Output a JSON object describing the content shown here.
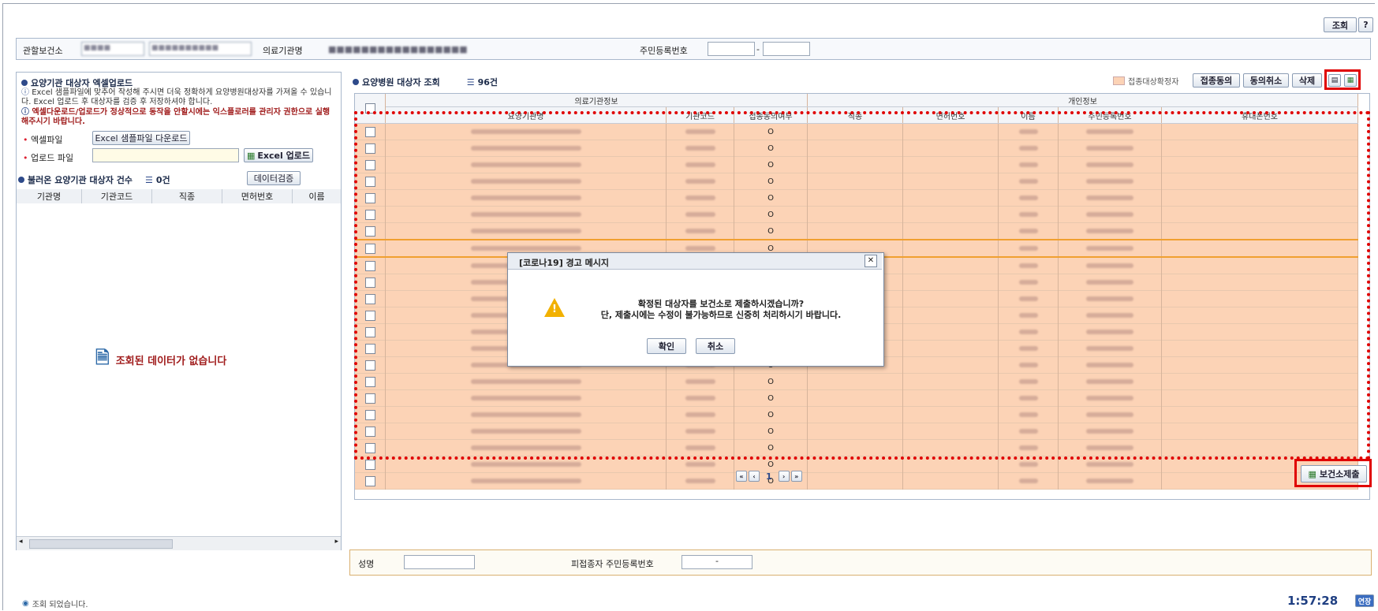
{
  "toolbar": {
    "search_label": "조회",
    "help_label": "?"
  },
  "filters": {
    "center_label": "관할보건소",
    "center_value1": "■■■■",
    "center_value2": "■■■■■■■■■■",
    "institution_label": "의료기관명",
    "institution_value": "■■■■■■■■■■■■■■■■■",
    "rrn_label": "주민등록번호",
    "rrn_sep": "-"
  },
  "upload": {
    "title": "요양기관 대상자 엑셀업로드",
    "info1": "Excel 샘플파일에 맞추어 작성해 주시면 더욱 정확하게 요양병원대상자를 가져올 수 있습니다. Excel 업로드 후 대상자를 검증 후 저장하셔야 합니다.",
    "info2": "엑셀다운로드/업로드가 정상적으로 동작을 안할시에는 익스플로러를 관리자 권한으로 실행해주시기 바랍니다.",
    "excel_file_label": "엑셀파일",
    "sample_download": "Excel 샘플파일 다운로드",
    "upload_file_label": "업로드 파일",
    "excel_upload_btn": "Excel 업로드"
  },
  "loaded": {
    "title": "불러온 요양기관 대상자 건수",
    "count": "0건",
    "verify_btn": "데이터검증",
    "columns": [
      "기관명",
      "기관코드",
      "직종",
      "면허번호",
      "이름"
    ],
    "empty_msg": "조회된 데이터가 없습니다"
  },
  "main": {
    "title": "요양병원 대상자 조회",
    "count": "96건",
    "legend_label": "접종대상확정자",
    "agree_btn": "접종동의",
    "cancel_agree_btn": "동의취소",
    "delete_btn": "삭제",
    "group1": "의료기관정보",
    "group2": "개인정보",
    "columns": [
      "요양기관명",
      "기관코드",
      "접종동의여부",
      "직종",
      "면허번호",
      "이름",
      "주민등록번호",
      "휴대폰번호"
    ],
    "consent_mark": "O",
    "pagination": {
      "current": "1"
    },
    "submit_btn": "보건소제출"
  },
  "bottom": {
    "name_label": "성명",
    "rrn_label": "피접종자 주민등록번호",
    "rrn_sep": "-"
  },
  "status": {
    "message": "조회 되었습니다.",
    "clock": "1:57:28",
    "extend": "연장"
  },
  "dialog": {
    "title": "[코로나19] 경고 메시지",
    "line1": "확정된 대상자를 보건소로 제출하시겠습니까?",
    "line2": "단, 제출시에는 수정이 불가능하므로 신중히 처리하시기 바랍니다.",
    "ok": "확인",
    "cancel": "취소"
  },
  "colors": {
    "row_bg": "#fcd3b6",
    "highlight": "#e00000",
    "accent": "#2e4a8a"
  }
}
